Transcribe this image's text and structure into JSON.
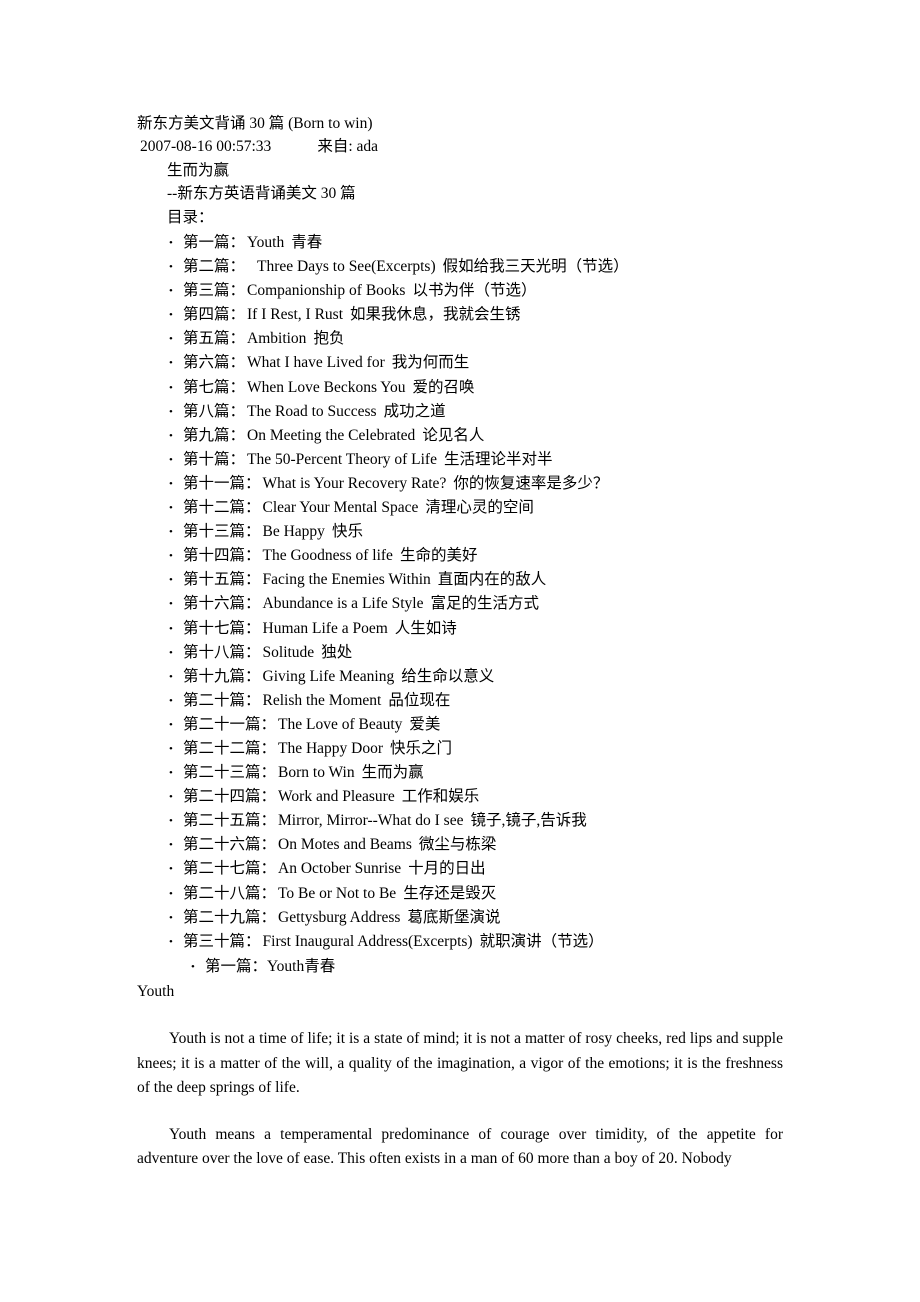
{
  "document": {
    "title": "新东方美文背诵 30 篇  (Born to win)",
    "date": "2007-08-16 00:57:33",
    "source_label": "来自: ada",
    "subtitle_cn": "生而为赢",
    "subtitle_dash": "--新东方英语背诵美文 30 篇",
    "toc_label": "目录：",
    "bullet_glyph": "•"
  },
  "toc": {
    "items": [
      {
        "index": "第一篇：",
        "en": "Youth",
        "cn": "青春",
        "extra_gap": false
      },
      {
        "index": "第二篇：",
        "en": "Three Days to See(Excerpts)",
        "cn": "假如给我三天光明（节选）",
        "extra_gap": true
      },
      {
        "index": "第三篇：",
        "en": "Companionship of Books",
        "cn": "以书为伴（节选）",
        "extra_gap": false
      },
      {
        "index": "第四篇：",
        "en": "If I Rest, I Rust",
        "cn": "如果我休息，我就会生锈",
        "extra_gap": false
      },
      {
        "index": "第五篇：",
        "en": "Ambition",
        "cn": "抱负",
        "extra_gap": false
      },
      {
        "index": "第六篇：",
        "en": "What I have Lived for",
        "cn": "我为何而生",
        "extra_gap": false
      },
      {
        "index": "第七篇：",
        "en": "When Love Beckons You",
        "cn": "爱的召唤",
        "extra_gap": false
      },
      {
        "index": "第八篇：",
        "en": "The Road to Success",
        "cn": "成功之道",
        "extra_gap": false
      },
      {
        "index": "第九篇：",
        "en": "On Meeting the Celebrated",
        "cn": "论见名人",
        "extra_gap": false
      },
      {
        "index": "第十篇：",
        "en": "The 50-Percent Theory of Life",
        "cn": "生活理论半对半",
        "extra_gap": false
      },
      {
        "index": "第十一篇：",
        "en": "What is Your Recovery Rate?",
        "cn": "你的恢复速率是多少？",
        "extra_gap": false
      },
      {
        "index": "第十二篇：",
        "en": "Clear Your Mental Space",
        "cn": "清理心灵的空间",
        "extra_gap": false
      },
      {
        "index": "第十三篇：",
        "en": "Be Happy",
        "cn": "快乐",
        "extra_gap": false
      },
      {
        "index": "第十四篇：",
        "en": "The Goodness of life",
        "cn": "生命的美好",
        "extra_gap": false
      },
      {
        "index": "第十五篇：",
        "en": "Facing the Enemies Within",
        "cn": "直面内在的敌人",
        "extra_gap": false
      },
      {
        "index": "第十六篇：",
        "en": "Abundance is a Life Style",
        "cn": "富足的生活方式",
        "extra_gap": false
      },
      {
        "index": "第十七篇：",
        "en": "Human Life a Poem",
        "cn": "人生如诗",
        "extra_gap": false
      },
      {
        "index": "第十八篇：",
        "en": "Solitude",
        "cn": "独处",
        "extra_gap": false
      },
      {
        "index": "第十九篇：",
        "en": "Giving Life Meaning",
        "cn": "给生命以意义",
        "extra_gap": false
      },
      {
        "index": "第二十篇：",
        "en": "Relish the Moment",
        "cn": "品位现在",
        "extra_gap": false
      },
      {
        "index": "第二十一篇：",
        "en": "The Love of Beauty",
        "cn": "爱美",
        "extra_gap": false
      },
      {
        "index": "第二十二篇：",
        "en": "The Happy Door",
        "cn": "快乐之门",
        "extra_gap": false
      },
      {
        "index": "第二十三篇：",
        "en": "Born to Win",
        "cn": "生而为赢",
        "extra_gap": false
      },
      {
        "index": "第二十四篇：",
        "en": "Work and Pleasure",
        "cn": "工作和娱乐",
        "extra_gap": false
      },
      {
        "index": "第二十五篇：",
        "en": "Mirror, Mirror--What do I see",
        "cn": "镜子,镜子,告诉我",
        "extra_gap": false
      },
      {
        "index": "第二十六篇：",
        "en": "On Motes and Beams",
        "cn": "微尘与栋梁",
        "extra_gap": false
      },
      {
        "index": "第二十七篇：",
        "en": "An October Sunrise",
        "cn": "十月的日出",
        "extra_gap": false
      },
      {
        "index": "第二十八篇：",
        "en": "To Be or Not to Be",
        "cn": "生存还是毁灭",
        "extra_gap": false
      },
      {
        "index": "第二十九篇：",
        "en": "Gettysburg Address",
        "cn": "葛底斯堡演说",
        "extra_gap": false
      },
      {
        "index": "第三十篇：",
        "en": "First Inaugural Address(Excerpts)",
        "cn": "就职演讲（节选）",
        "extra_gap": false
      }
    ],
    "repeat_entry": {
      "index": "第一篇：",
      "en": "Youth",
      "cn": "青春"
    }
  },
  "article": {
    "heading": "Youth",
    "paragraphs": [
      "Youth is not a time of life; it is a state of mind; it is not a matter of rosy cheeks, red lips and supple knees; it is a matter of the will, a quality of the imagination, a vigor of the emotions; it is the freshness of the deep springs of life.",
      "Youth means a temperamental predominance of courage over timidity, of the appetite for adventure over the love of ease. This often exists in a man of 60 more than a boy of 20. Nobody"
    ]
  },
  "colors": {
    "page_background": "#ffffff",
    "text": "#000000"
  }
}
